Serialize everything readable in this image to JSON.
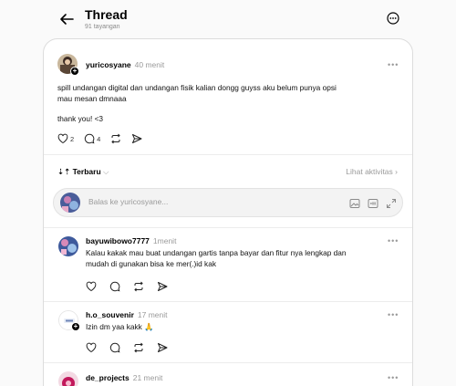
{
  "header": {
    "title": "Thread",
    "views": "91 tayangan"
  },
  "post": {
    "username": "yuricosyane",
    "time": "40 menit",
    "body_line1": "spill undangan digital dan undangan fisik kalian dongg guyss aku belum punya opsi",
    "body_line2": "mau mesan dmnaaa",
    "body_line3": "thank you! <3",
    "likes": "2",
    "comments": "4"
  },
  "sort": {
    "label": "Terbaru",
    "activity_link": "Lihat aktivitas"
  },
  "reply_box": {
    "placeholder": "Balas ke yuricosyane..."
  },
  "comments": [
    {
      "username": "bayuwibowo7777",
      "time": "1menit",
      "line1": "Kalau kakak mau buat undangan gartis tanpa bayar dan fitur nya lengkap dan",
      "line2": "mudah di gunakan bisa ke mer(.)id kak"
    },
    {
      "username": "h.o_souvenir",
      "time": "17 menit",
      "line1": "Izin dm yaa kakk 🙏"
    },
    {
      "username": "de_projects",
      "time": "21 menit"
    }
  ],
  "colors": {
    "background": "#fafafa",
    "card": "#ffffff",
    "muted": "#9a9a9a",
    "border": "#dcdcdc"
  },
  "icons": [
    "back-arrow-icon",
    "more-circle-icon",
    "heart-icon",
    "comment-icon",
    "repost-icon",
    "share-icon",
    "image-icon",
    "gif-icon",
    "expand-icon"
  ]
}
